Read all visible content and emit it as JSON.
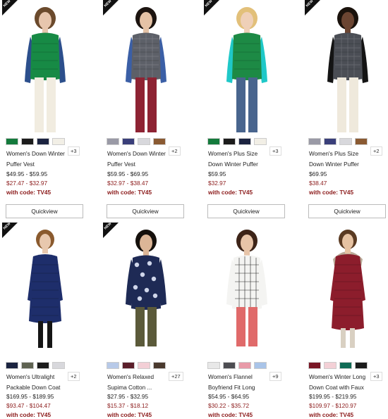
{
  "products": [
    {
      "new": true,
      "badge": "NEW",
      "name": "Women's Down Winter Puffer Vest",
      "price": "$49.95 - $59.95",
      "sale": "$27.47 - $32.97",
      "code": "with code: TV45",
      "more": "+3",
      "quickview": "Quickview",
      "swatches": [
        "#147a3c",
        "#1c1c1c",
        "#1b2340",
        "#f2efe6"
      ],
      "figure": {
        "skin": "#e7c6ad",
        "hair": "#6b4a2c",
        "top": "#178a45",
        "sleeve": "#2c4f8c",
        "pants": "#f1ece0"
      }
    },
    {
      "new": true,
      "badge": "NEW",
      "name": "Women's Down Winter Puffer Vest",
      "price": "$59.95 - $69.95",
      "sale": "$32.97 - $38.47",
      "code": "with code: TV45",
      "more": "+2",
      "quickview": "Quickview",
      "swatches": [
        "#9a9aa6",
        "#3a3f7a",
        "#d8d8dc",
        "#8a5a32"
      ],
      "figure": {
        "skin": "#e4c2a6",
        "hair": "#1c1410",
        "top": "#5d6068",
        "sleeve": "#3b5fa6",
        "pants": "#8e2333"
      }
    },
    {
      "new": true,
      "badge": "NEW",
      "name": "Women's Plus Size Down Winter Puffer",
      "price": "$59.95",
      "sale": "$32.97",
      "code": "with code: TV45",
      "more": "+3",
      "quickview": "Quickview",
      "swatches": [
        "#147a3c",
        "#1c1c1c",
        "#1b2340",
        "#f2efe6"
      ],
      "figure": {
        "skin": "#efd0b8",
        "hair": "#e2c07a",
        "top": "#1d8a45",
        "sleeve": "#1fc8c8",
        "pants": "#49658e"
      }
    },
    {
      "new": true,
      "badge": "NEW",
      "name": "Women's Plus Size Down Winter Puffer",
      "price": "$69.95",
      "sale": "$38.47",
      "code": "with code: TV45",
      "more": "+2",
      "quickview": "Quickview",
      "swatches": [
        "#9a9aa6",
        "#3a3f7a",
        "#d8d8dc",
        "#8a5a32"
      ],
      "figure": {
        "skin": "#6b4532",
        "hair": "#1a120c",
        "top": "#4b4e55",
        "sleeve": "#141414",
        "pants": "#efe9dc"
      }
    },
    {
      "new": true,
      "badge": "NEW",
      "name": "Women's Ultralight Packable Down Coat",
      "price": "$169.95 - $189.95",
      "sale": "$93.47 - $104.47",
      "code": "with code: TV45",
      "more": "+2",
      "quickview": "",
      "swatches": [
        "#1b2340",
        "#5f6352",
        "#1c1c1c",
        "#d8d8dc"
      ],
      "figure": {
        "skin": "#e8c8ae",
        "hair": "#8a5a2e",
        "top": "#1e2e6b",
        "sleeve": "#1e2e6b",
        "pants": "#151515"
      }
    },
    {
      "new": true,
      "badge": "NEW",
      "name": "Women's Relaxed Supima Cotton ...",
      "price": "$27.95 - $32.95",
      "sale": "$15.37 - $18.12",
      "code": "with code: TV45",
      "more": "+27",
      "quickview": "",
      "swatches": [
        "#b7c9e8",
        "#5b1e2a",
        "#f3cfd6",
        "#4a3a2e"
      ],
      "figure": {
        "skin": "#dcb697",
        "hair": "#15100c",
        "top": "#1e2a55",
        "sleeve": "#1e2a55",
        "pants": "#5b5a3a"
      }
    },
    {
      "new": false,
      "badge": "",
      "name": "Women's Flannel Boyfriend Fit Long",
      "price": "$54.95 - $64.95",
      "sale": "$30.22 - $35.72",
      "code": "with code: TV45",
      "more": "+9",
      "quickview": "",
      "swatches": [
        "#e8e8e8",
        "#4d4d52",
        "#e89aa8",
        "#a9c4e8"
      ],
      "figure": {
        "skin": "#e7c4a8",
        "hair": "#3d2418",
        "top": "#f4f4f2",
        "sleeve": "#f4f4f2",
        "pants": "#e06a6a"
      }
    },
    {
      "new": false,
      "badge": "",
      "name": "Women's Winter Long Down Coat with Faux",
      "price": "$199.95 - $219.95",
      "sale": "$109.97 - $120.97",
      "code": "with code: TV45",
      "more": "+3",
      "quickview": "",
      "swatches": [
        "#7a1726",
        "#f3d0d6",
        "#0f6b55",
        "#1c1c1c"
      ],
      "figure": {
        "skin": "#e6c2a2",
        "hair": "#5a3a22",
        "top": "#8c1d2c",
        "sleeve": "#8c1d2c",
        "pants": "#d9d0c2"
      }
    }
  ]
}
